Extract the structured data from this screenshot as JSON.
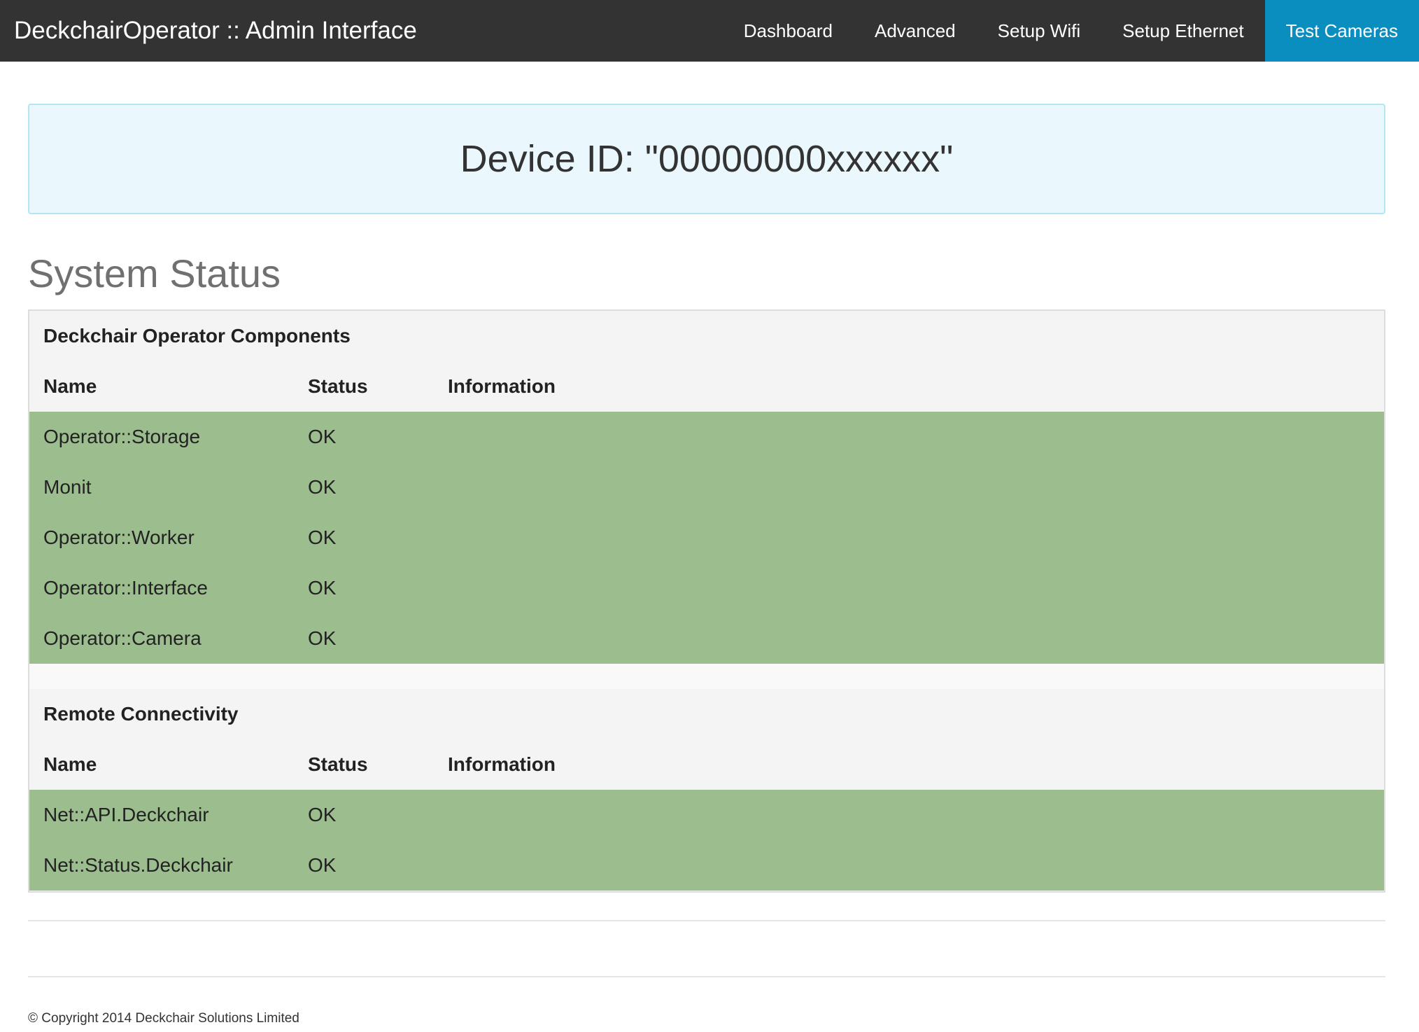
{
  "header": {
    "brand": "DeckchairOperator :: Admin Interface",
    "nav": [
      {
        "label": "Dashboard"
      },
      {
        "label": "Advanced"
      },
      {
        "label": "Setup Wifi"
      },
      {
        "label": "Setup Ethernet"
      },
      {
        "label": "Test Cameras"
      }
    ],
    "active_nav": "Test Cameras"
  },
  "device": {
    "label": "Device ID: \"00000000xxxxxx\""
  },
  "status": {
    "title": "System Status",
    "groups": [
      {
        "title": "Deckchair Operator Components",
        "columns": {
          "name": "Name",
          "status": "Status",
          "info": "Information"
        },
        "rows": [
          {
            "name": "Operator::Storage",
            "status": "OK",
            "info": ""
          },
          {
            "name": "Monit",
            "status": "OK",
            "info": ""
          },
          {
            "name": "Operator::Worker",
            "status": "OK",
            "info": ""
          },
          {
            "name": "Operator::Interface",
            "status": "OK",
            "info": ""
          },
          {
            "name": "Operator::Camera",
            "status": "OK",
            "info": ""
          }
        ]
      },
      {
        "title": "Remote Connectivity",
        "columns": {
          "name": "Name",
          "status": "Status",
          "info": "Information"
        },
        "rows": [
          {
            "name": "Net::API.Deckchair",
            "status": "OK",
            "info": ""
          },
          {
            "name": "Net::Status.Deckchair",
            "status": "OK",
            "info": ""
          }
        ]
      }
    ]
  },
  "footer": {
    "copyright": "© Copyright 2014 Deckchair Solutions Limited"
  },
  "colors": {
    "topbar": "#333333",
    "active_nav": "#0a8dbf",
    "banner_bg": "#eaf8fd",
    "ok_row": "#9cbe8e"
  }
}
